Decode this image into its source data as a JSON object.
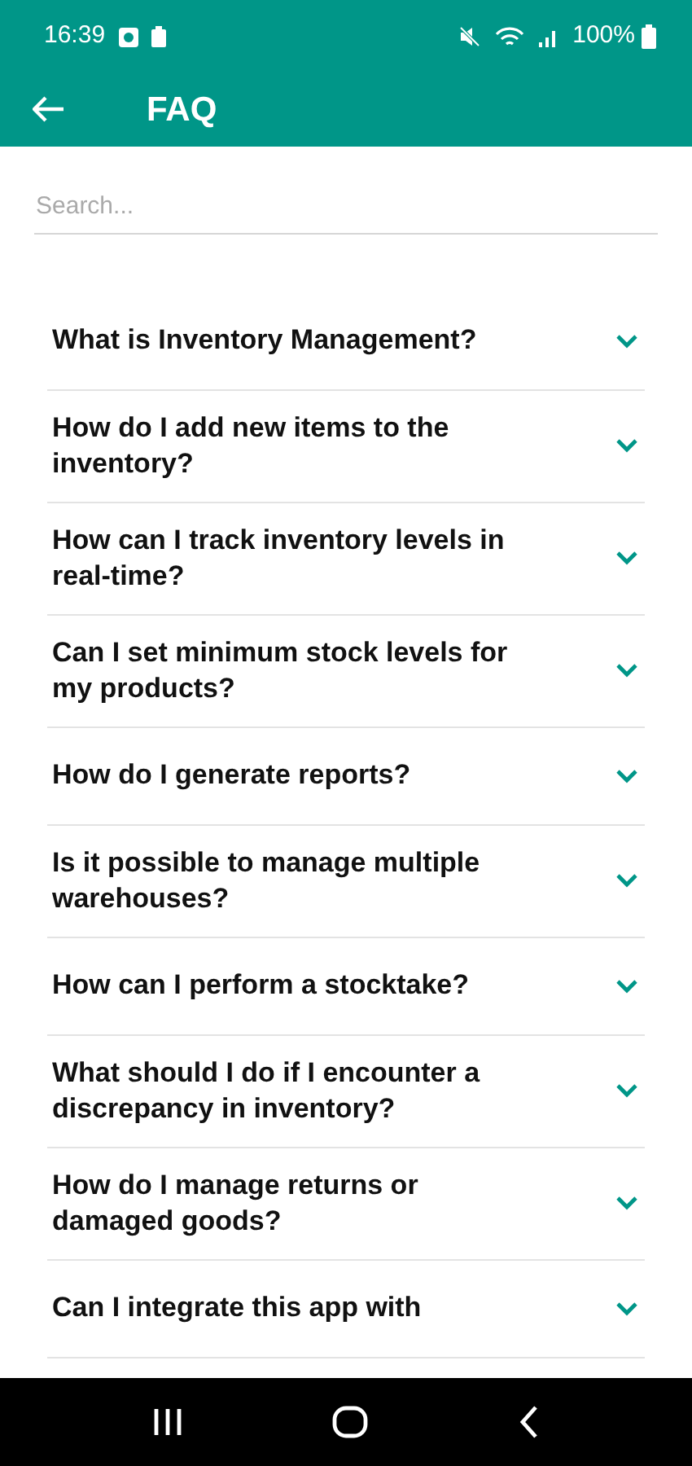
{
  "status_bar": {
    "time": "16:39",
    "battery": "100%"
  },
  "app_bar": {
    "title": "FAQ"
  },
  "search": {
    "placeholder": "Search..."
  },
  "faqs": [
    {
      "question": "What is Inventory Management?",
      "expanded": false
    },
    {
      "question": "How do I add new items to the inventory?",
      "expanded": false
    },
    {
      "question": "How can I track inventory levels in real-time?",
      "expanded": false
    },
    {
      "question": "Can I set minimum stock levels for my products?",
      "expanded": false
    },
    {
      "question": "How do I generate reports?",
      "expanded": false
    },
    {
      "question": "Is it possible to manage multiple warehouses?",
      "expanded": false
    },
    {
      "question": "How can I perform a stocktake?",
      "expanded": false
    },
    {
      "question": "What should I do if I encounter a discrepancy in inventory?",
      "expanded": false
    },
    {
      "question": "How do I manage returns or damaged goods?",
      "expanded": false
    },
    {
      "question": "Can I integrate this app with",
      "expanded": false
    }
  ]
}
